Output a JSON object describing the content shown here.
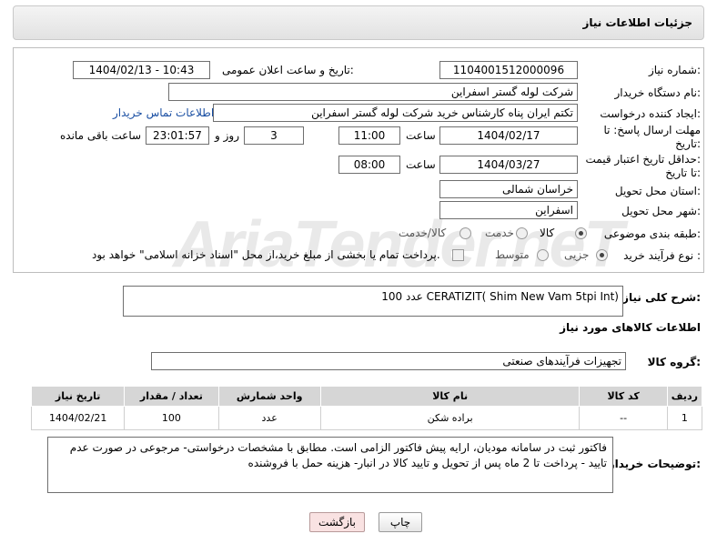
{
  "header": {
    "title": "جزئیات اطلاعات نیاز"
  },
  "form": {
    "need_number": {
      "label": "شماره نیاز:",
      "value": "1104001512000096"
    },
    "announce_datetime": {
      "label": "تاریخ و ساعت اعلان عمومی:",
      "value": "1404/02/13 - 10:43"
    },
    "buyer_org": {
      "label": "نام دستگاه خریدار:",
      "value": "شرکت لوله گستر اسفراین"
    },
    "requester": {
      "label": "ایجاد کننده درخواست:",
      "value": "تکتم ایران پناه کارشناس خرید شرکت لوله گستر اسفراین",
      "contact_link": "اطلاعات تماس خریدار"
    },
    "reply_deadline": {
      "label_line1": "مهلت ارسال پاسخ: تا",
      "label_line2": "تاریخ:",
      "date": "1404/02/17",
      "time_label": "ساعت",
      "time": "11:00",
      "days": "3",
      "days_label": "روز و",
      "remaining": "23:01:57",
      "remaining_label": "ساعت باقی مانده"
    },
    "price_validity": {
      "label_line1": "حداقل تاریخ اعتبار قیمت:",
      "label_line2": "تا تاریخ:",
      "date": "1404/03/27",
      "time_label": "ساعت",
      "time": "08:00"
    },
    "delivery_province": {
      "label": "استان محل تحویل:",
      "value": "خراسان شمالی"
    },
    "delivery_city": {
      "label": "شهر محل تحویل:",
      "value": "اسفراین"
    },
    "category": {
      "label": "طبقه بندی موضوعی:",
      "options": [
        "کالا",
        "خدمت",
        "کالا/خدمت"
      ],
      "selected": "کالا"
    },
    "purchase_process": {
      "label": "نوع فرآیند خرید :",
      "options": [
        "جزیی",
        "متوسط"
      ],
      "selected": "جزیی",
      "payment_note": "پرداخت تمام یا بخشی از مبلغ خرید،از محل \"اسناد خزانه اسلامی\" خواهد بود."
    }
  },
  "general_description": {
    "label": "شرح کلی نیاز:",
    "value": "100 عدد CERATIZIT( Shim New Vam 5tpi Int)"
  },
  "goods_info": {
    "title": "اطلاعات کالاهای مورد نیاز",
    "group_label": "گروه کالا:",
    "group_value": "تجهیزات فرآیندهای صنعتی"
  },
  "items_table": {
    "headers": [
      "ردیف",
      "کد کالا",
      "نام کالا",
      "واحد شمارش",
      "تعداد / مقدار",
      "تاریخ نیاز"
    ],
    "rows": [
      [
        "1",
        "--",
        "براده شکن",
        "عدد",
        "100",
        "1404/02/21"
      ]
    ]
  },
  "buyer_notes": {
    "label": "توضیحات خریدار:",
    "value": "فاکتور ثبت در سامانه مودیان، ارایه پیش فاکتور الزامی است. مطابق با مشخصات درخواستی- مرجوعی در صورت عدم تایید - پرداخت تا 2 ماه پس از تحویل و تایید کالا در انبار- هزینه حمل با فروشنده"
  },
  "buttons": {
    "print": "چاپ",
    "back": "بازگشت"
  },
  "watermark": "AriaTender.neT",
  "colors": {
    "link": "#1a4fa3",
    "table_header": "#d6d6d6",
    "back_button": "#f9e2e2"
  }
}
